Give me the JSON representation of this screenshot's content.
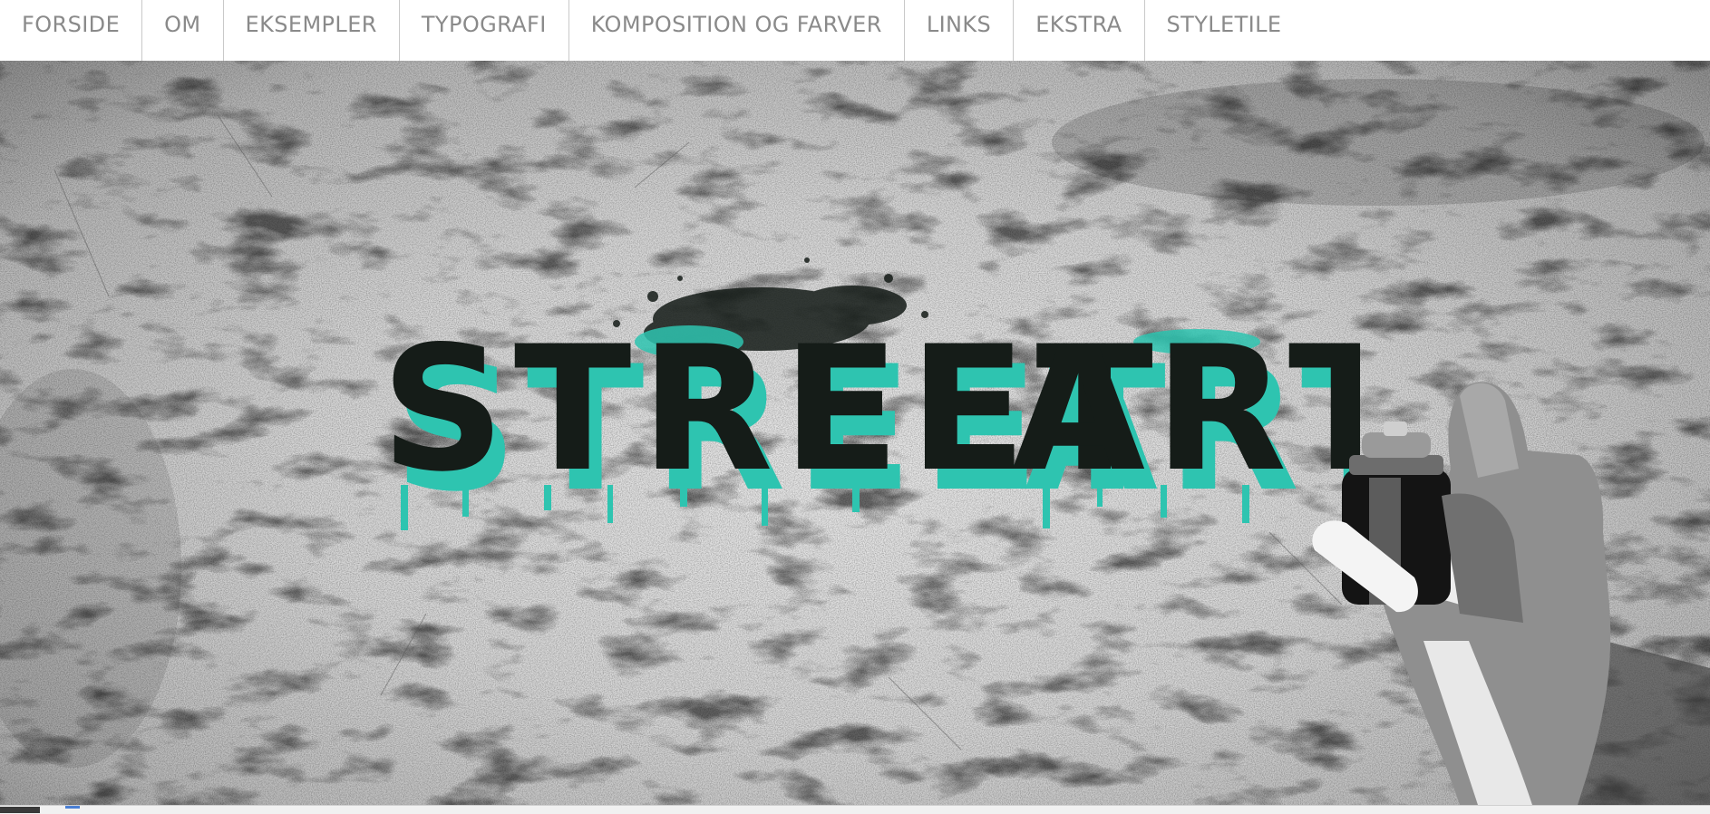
{
  "nav": {
    "items": [
      {
        "label": "FORSIDE"
      },
      {
        "label": "OM"
      },
      {
        "label": "EKSEMPLER"
      },
      {
        "label": "TYPOGRAFI"
      },
      {
        "label": "KOMPOSITION OG FARVER"
      },
      {
        "label": "LINKS"
      },
      {
        "label": "EKSTRA"
      },
      {
        "label": "STYLETILE"
      }
    ]
  },
  "hero": {
    "title": "STREET ART",
    "accent_color": "#2ec4b0",
    "ink_color": "#151c18"
  }
}
